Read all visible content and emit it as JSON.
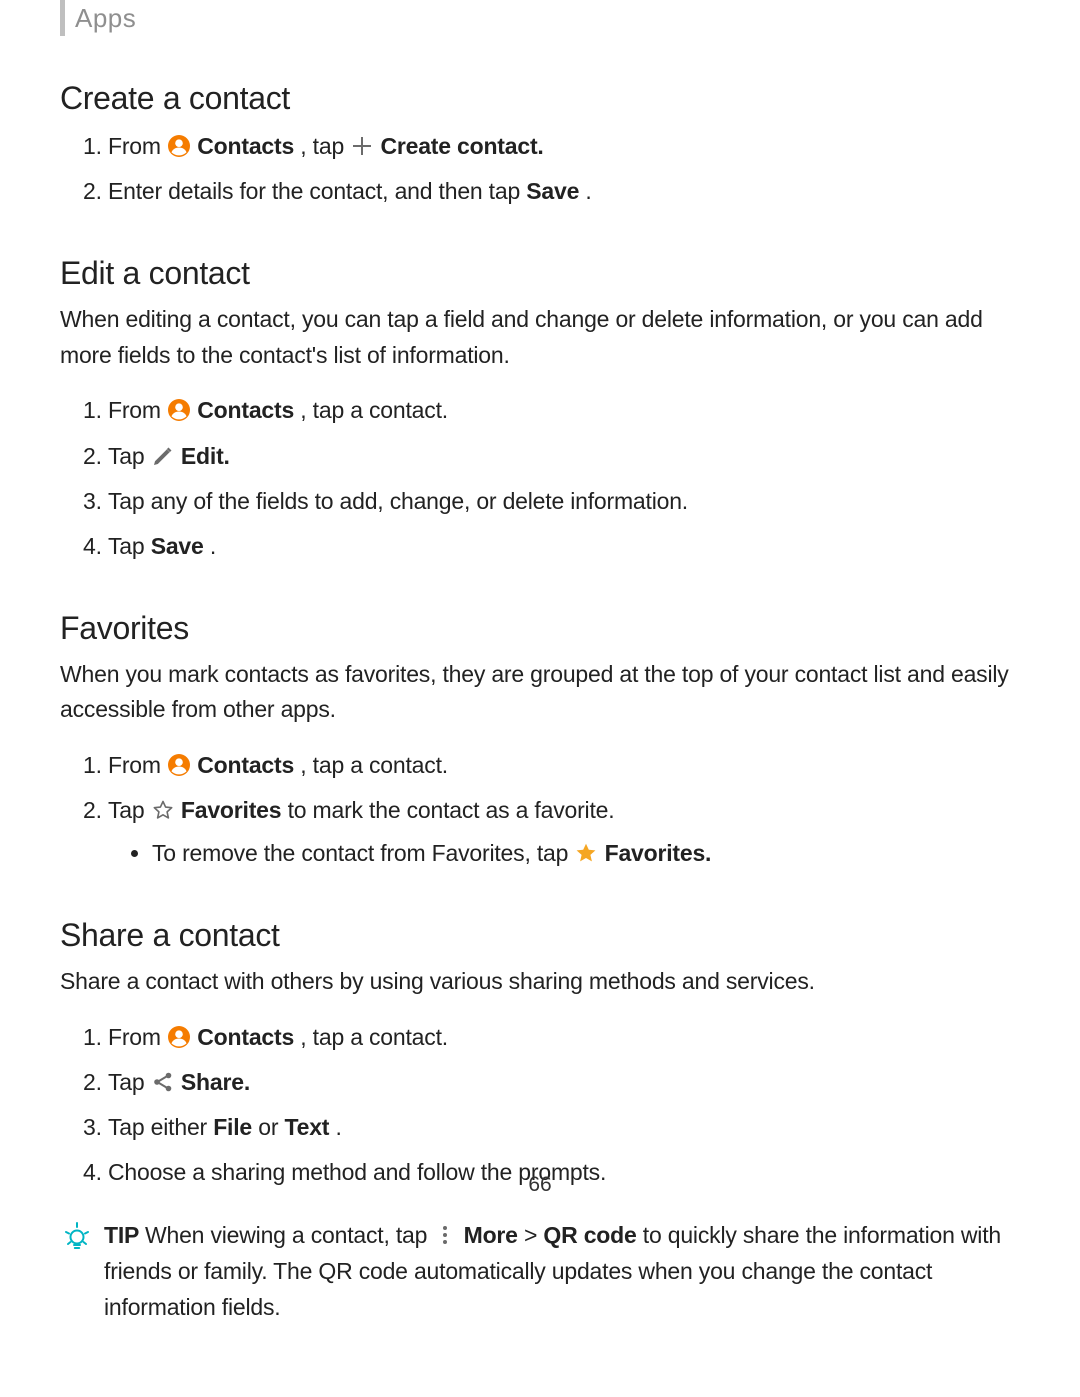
{
  "header": {
    "section_label": "Apps"
  },
  "create": {
    "title": "Create a contact",
    "step1_from": "From ",
    "step1_contacts": "Contacts",
    "step1_tap": ", tap ",
    "step1_createcontact": "Create contact.",
    "step2_prefix": "Enter details for the contact, and then tap ",
    "step2_save": "Save",
    "step2_suffix": "."
  },
  "edit": {
    "title": "Edit a contact",
    "intro": "When editing a contact, you can tap a field and change or delete information, or you can add more fields to the contact's list of information.",
    "step1_from": "From ",
    "step1_contacts": "Contacts",
    "step1_rest": ", tap a contact.",
    "step2_tap": "Tap ",
    "step2_edit": "Edit.",
    "step3": "Tap any of the fields to add, change, or delete information.",
    "step4_tap": "Tap ",
    "step4_save": "Save",
    "step4_suffix": "."
  },
  "favorites": {
    "title": "Favorites",
    "intro": "When you mark contacts as favorites, they are grouped at the top of your contact list and easily accessible from other apps.",
    "step1_from": "From ",
    "step1_contacts": "Contacts",
    "step1_rest": ", tap a contact.",
    "step2_tap": "Tap ",
    "step2_fav": "Favorites",
    "step2_rest": " to mark the contact as a favorite.",
    "sub_prefix": "To remove the contact from Favorites, tap ",
    "sub_fav": "Favorites."
  },
  "share": {
    "title": "Share a contact",
    "intro": "Share a contact with others by using various sharing methods and services.",
    "step1_from": "From ",
    "step1_contacts": "Contacts",
    "step1_rest": ", tap a contact.",
    "step2_tap": "Tap ",
    "step2_share": "Share.",
    "step3_a": "Tap either ",
    "step3_file": "File",
    "step3_or": " or ",
    "step3_text": "Text",
    "step3_end": ".",
    "step4": "Choose a sharing method and follow the prompts."
  },
  "tip": {
    "label": "TIP ",
    "a": " When viewing a contact, tap ",
    "more": "More",
    "gt": " > ",
    "qr": "QR code",
    "b": " to quickly share the information with friends or family. The QR code automatically updates when you change the contact information fields."
  },
  "page_number": "66"
}
